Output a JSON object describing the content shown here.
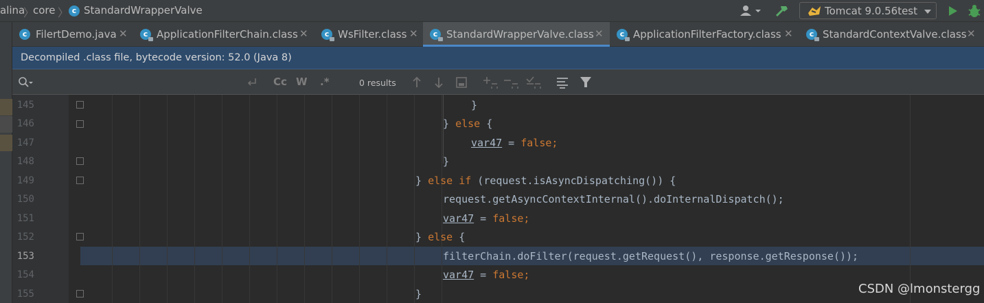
{
  "breadcrumbs": [
    "alina",
    "core",
    "StandardWrapperValve"
  ],
  "run_config": {
    "label": "Tomcat 9.0.56test"
  },
  "tabs": [
    {
      "label": "FilertDemo.java"
    },
    {
      "label": "ApplicationFilterChain.class"
    },
    {
      "label": "WsFilter.class"
    },
    {
      "label": "StandardWrapperValve.class"
    },
    {
      "label": "ApplicationFilterFactory.class"
    },
    {
      "label": "StandardContextValve.class"
    }
  ],
  "active_tab": "StandardWrapperValve.class",
  "banner": {
    "text": "Decompiled .class file, bytecode version: 52.0 (Java 8)"
  },
  "find": {
    "results": "0 results",
    "case_label": "Cc",
    "word_label": "W",
    "regex_label": ".*"
  },
  "current_line": "153",
  "lines": [
    {
      "num": "145",
      "code": "}"
    },
    {
      "num": "146",
      "code_a": "} ",
      "kw": "else",
      "code_b": " {"
    },
    {
      "num": "147",
      "var": "var47",
      "mid": " = ",
      "kw": "false",
      "tail": ";"
    },
    {
      "num": "148",
      "code": "}"
    },
    {
      "num": "149",
      "code_a": "} ",
      "kw": "else if",
      "code_b": " (request.isAsyncDispatching()) {"
    },
    {
      "num": "150",
      "code": "request.getAsyncContextInternal().doInternalDispatch();"
    },
    {
      "num": "151",
      "var": "var47",
      "mid": " = ",
      "kw": "false",
      "tail": ";"
    },
    {
      "num": "152",
      "code_a": "} ",
      "kw": "else",
      "code_b": " {"
    },
    {
      "num": "153",
      "code": "filterChain.doFilter(request.getRequest(), response.getResponse());"
    },
    {
      "num": "154",
      "var": "var47",
      "mid": " = ",
      "kw": "false",
      "tail": ";"
    },
    {
      "num": "155",
      "code": "}"
    }
  ],
  "watermark": "CSDN @lmonstergg",
  "colors": {
    "keyword": "#cc7832",
    "text": "#a9b7c6",
    "banner": "#2d4a6b",
    "current_line": "#323f52"
  }
}
